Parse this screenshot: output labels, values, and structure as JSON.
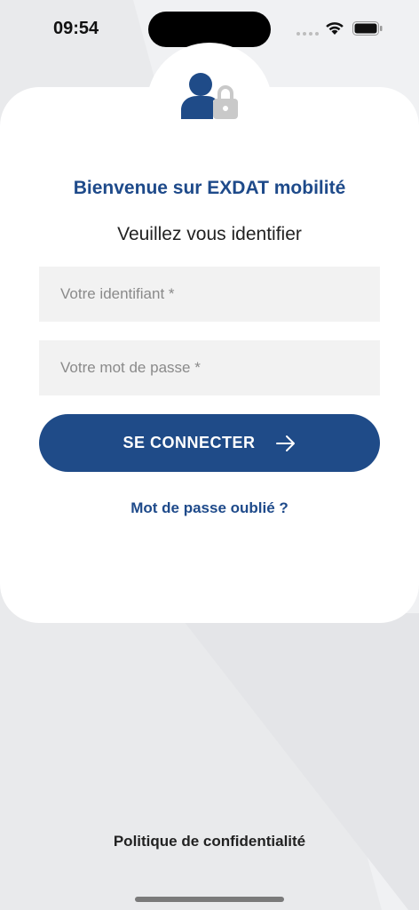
{
  "status_bar": {
    "time": "09:54"
  },
  "login": {
    "welcome": "Bienvenue sur EXDAT mobilité",
    "subtitle": "Veuillez vous identifier",
    "username_placeholder": "Votre identifiant *",
    "username_value": "",
    "password_placeholder": "Votre mot de passe *",
    "password_value": "",
    "connect_label": "SE CONNECTER",
    "forgot_label": "Mot de passe oublié ?"
  },
  "footer": {
    "privacy_label": "Politique de confidentialité"
  },
  "icons": {
    "header": "user-lock-icon",
    "button": "arrow-right-icon"
  },
  "colors": {
    "brand": "#1f4b88",
    "title": "#1e4a8a",
    "field_bg": "#f2f2f2",
    "background": "#e9eaec"
  }
}
